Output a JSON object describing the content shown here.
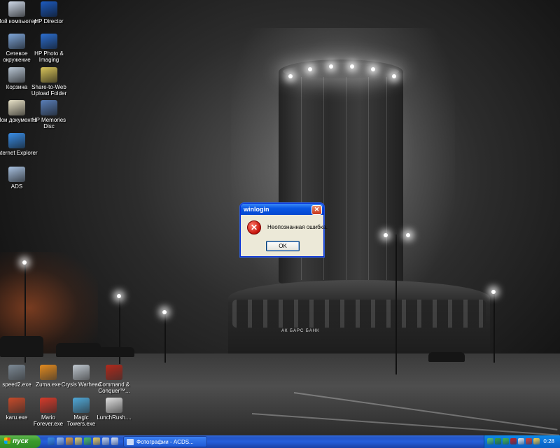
{
  "desktop": {
    "building_sign": "АК БАРС БАНК",
    "icons_left": [
      {
        "label": "Мой компьютер",
        "icon": "my-computer-icon",
        "color": "#cfd9e8"
      },
      {
        "label": "Сетевое окружение",
        "icon": "network-icon",
        "color": "#7fa6d8"
      },
      {
        "label": "Корзина",
        "icon": "recycle-bin-icon",
        "color": "#b9c6d4"
      },
      {
        "label": "Мои документы",
        "icon": "my-documents-icon",
        "color": "#e8e2c8"
      },
      {
        "label": "Internet Explorer",
        "icon": "internet-explorer-icon",
        "color": "#3a8ee6"
      },
      {
        "label": "ADS",
        "icon": "ads-icon",
        "color": "#a8c1e0"
      }
    ],
    "icons_hp": [
      {
        "label": "HP Director",
        "icon": "hp-director-icon",
        "color": "#1d5bbf"
      },
      {
        "label": "HP Photo & Imaging",
        "icon": "hp-photo-icon",
        "color": "#2d6fd0"
      },
      {
        "label": "Share-to-Web Upload Folder",
        "icon": "share-to-web-icon",
        "color": "#d8c45a"
      },
      {
        "label": "HP Memories Disc",
        "icon": "hp-memories-icon",
        "color": "#5a7fb8"
      }
    ],
    "icons_bottom": [
      {
        "label": "speed2.exe",
        "icon": "speed2-icon",
        "color": "#7d8a96"
      },
      {
        "label": "Zuma.exe",
        "icon": "zuma-icon",
        "color": "#e38b1f"
      },
      {
        "label": "Crysis Warhead",
        "icon": "crysis-icon",
        "color": "#c0c8d0"
      },
      {
        "label": "Command & Conquer™...",
        "icon": "command-conquer-icon",
        "color": "#b22a1c"
      },
      {
        "label": "karu.exe",
        "icon": "karu-icon",
        "color": "#c74a2a"
      },
      {
        "label": "Mario Forever.exe",
        "icon": "mario-icon",
        "color": "#d63a2a"
      },
      {
        "label": "Magic Towers.exe",
        "icon": "magic-towers-icon",
        "color": "#4fa8d8"
      },
      {
        "label": "LunchRush....",
        "icon": "lunchrush-icon",
        "color": "#e0e0e0"
      }
    ]
  },
  "dialog": {
    "title": "winlogin",
    "message": "Неопознанная ошибка.",
    "ok_label": "OK",
    "close_glyph": "✕",
    "error_glyph": "✕"
  },
  "taskbar": {
    "start_label": "пуск",
    "task_label": "Фотографии - ACDS...",
    "clock": "0:28",
    "quick_launch": [
      {
        "icon": "ie-quicklaunch-icon",
        "color": "#3a8ee6"
      },
      {
        "icon": "show-desktop-icon",
        "color": "#9fc0ef"
      },
      {
        "icon": "media-player-icon",
        "color": "#e8a33a"
      },
      {
        "icon": "explorer-icon",
        "color": "#e8d36a"
      },
      {
        "icon": "messenger-icon",
        "color": "#4fc05a"
      },
      {
        "icon": "folder-icon",
        "color": "#f0cf5a"
      },
      {
        "icon": "program-icon",
        "color": "#c8d6ee"
      },
      {
        "icon": "window-icon",
        "color": "#dfe8f8"
      }
    ],
    "tray": [
      {
        "icon": "network-tray-icon",
        "color": "#5ec46a"
      },
      {
        "icon": "antivirus-tray-icon",
        "color": "#3a9f3a"
      },
      {
        "icon": "messenger-tray-icon",
        "color": "#48b848"
      },
      {
        "icon": "kaspersky-tray-icon",
        "color": "#c81e1e"
      },
      {
        "icon": "volume-tray-icon",
        "color": "#e9e9e9"
      },
      {
        "icon": "security-tray-icon",
        "color": "#e33a2a"
      },
      {
        "icon": "update-tray-icon",
        "color": "#ffd24a"
      }
    ]
  }
}
